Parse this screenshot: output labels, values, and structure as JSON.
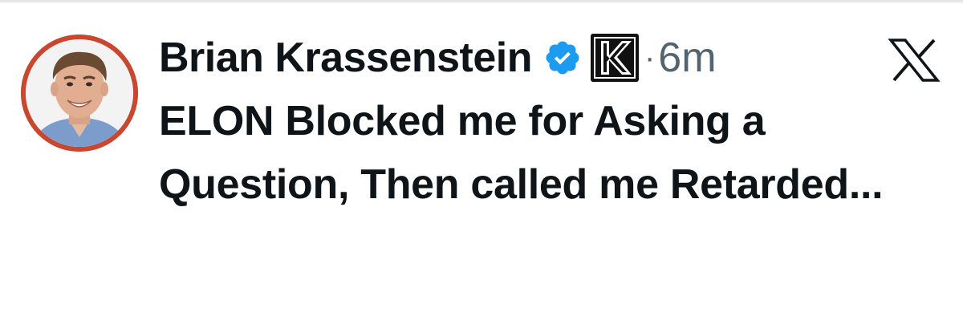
{
  "tweet": {
    "author": {
      "display_name": "Brian Krassenstein",
      "verified_icon": "verified-badge-icon",
      "affiliate_icon": "k-affiliate-badge-icon",
      "avatar": "avatar-photo"
    },
    "separator": "·",
    "timestamp": "6m",
    "text": "ELON Blocked me for Asking a Question, Then called me Retarded...",
    "close_label": "X",
    "close_icon": "x-logo-icon"
  },
  "colors": {
    "text": "#0f1419",
    "secondary": "#536471",
    "verified_blue": "#1d9bf0",
    "avatar_ring": "#c9472f"
  }
}
